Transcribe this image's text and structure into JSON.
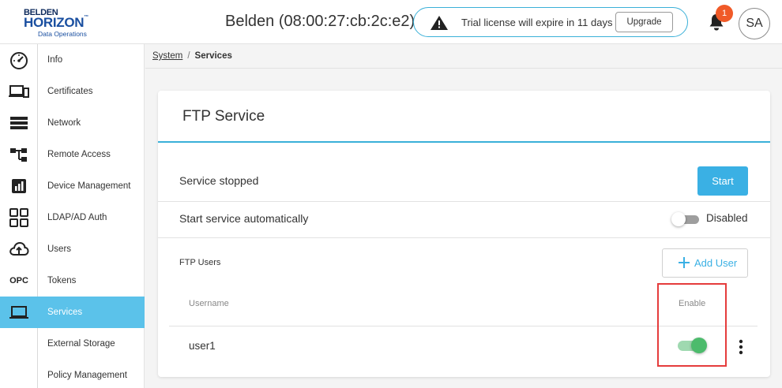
{
  "brand": {
    "line1": "BELDEN",
    "line2": "HORIZON",
    "tm": "™",
    "line3": "Data Operations"
  },
  "header": {
    "device_title": "Belden (08:00:27:cb:2c:e2)",
    "trial_message": "Trial license will expire in 11 days",
    "upgrade_label": "Upgrade",
    "notification_count": "1",
    "user_initials": "SA"
  },
  "rail": {
    "items": [
      {
        "icon": "dashboard-gauge-icon"
      },
      {
        "icon": "devices-icon"
      },
      {
        "icon": "list-icon"
      },
      {
        "icon": "topology-icon"
      },
      {
        "icon": "analytics-icon"
      },
      {
        "icon": "apps-grid-icon"
      },
      {
        "icon": "cloud-upload-icon"
      },
      {
        "label": "OPC"
      },
      {
        "icon": "laptop-icon",
        "active": true
      }
    ]
  },
  "subnav": {
    "items": [
      {
        "label": "Info"
      },
      {
        "label": "Certificates"
      },
      {
        "label": "Network"
      },
      {
        "label": "Remote Access"
      },
      {
        "label": "Device Management"
      },
      {
        "label": "LDAP/AD Auth"
      },
      {
        "label": "Users"
      },
      {
        "label": "Tokens"
      },
      {
        "label": "Services",
        "active": true
      },
      {
        "label": "External Storage"
      },
      {
        "label": "Policy Management"
      }
    ]
  },
  "breadcrumb": {
    "parent": "System",
    "separator": "/",
    "current": "Services"
  },
  "card": {
    "title": "FTP Service",
    "status_text": "Service stopped",
    "start_label": "Start",
    "auto_start_label": "Start service automatically",
    "auto_start_state": "Disabled",
    "ftp_users_label": "FTP Users",
    "add_user_label": "Add User",
    "columns": {
      "username": "Username",
      "enable": "Enable"
    },
    "rows": [
      {
        "username": "user1",
        "enabled": true
      }
    ]
  },
  "colors": {
    "accent": "#5bc2ea",
    "button": "#3ab0e4",
    "toggle_on": "#4cbb6c",
    "badge": "#f05a28",
    "highlight": "#e53c3c"
  }
}
